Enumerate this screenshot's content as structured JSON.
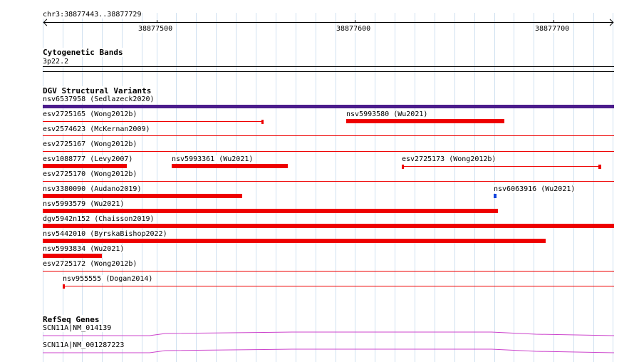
{
  "locus": "chr3:38877443..38877729",
  "ruler_ticks": [
    "38877500",
    "38877600",
    "38877700"
  ],
  "colors": {
    "grid": "#cfe0f0",
    "variant": "#ee0000",
    "variant_purple": "#4b1c8c",
    "variant_blue": "#1144dd",
    "gene": "#cc44cc"
  },
  "tracks": {
    "cytoband": {
      "title": "Cytogenetic Bands",
      "band": "3p22.2"
    },
    "dgv": {
      "title": "DGV Structural Variants",
      "variants": [
        {
          "label": "nsv6537958 (Sedlazeck2020)"
        },
        {
          "label": "esv2725165 (Wong2012b)"
        },
        {
          "label": "nsv5993580 (Wu2021)"
        },
        {
          "label": "esv2574623 (McKernan2009)"
        },
        {
          "label": "esv2725167 (Wong2012b)"
        },
        {
          "label": "esv1088777 (Levy2007)"
        },
        {
          "label": "nsv5993361 (Wu2021)"
        },
        {
          "label": "esv2725173 (Wong2012b)"
        },
        {
          "label": "esv2725170 (Wong2012b)"
        },
        {
          "label": "nsv3380090 (Audano2019)"
        },
        {
          "label": "nsv6063916 (Wu2021)"
        },
        {
          "label": "nsv5993579 (Wu2021)"
        },
        {
          "label": "dgv5942n152 (Chaisson2019)"
        },
        {
          "label": "nsv5442010 (ByrskaBishop2022)"
        },
        {
          "label": "nsv5993834 (Wu2021)"
        },
        {
          "label": "esv2725172 (Wong2012b)"
        },
        {
          "label": "nsv955555 (Dogan2014)"
        }
      ]
    },
    "refseq": {
      "title": "RefSeq Genes",
      "genes": [
        {
          "label": "SCN11A|NM_014139"
        },
        {
          "label": "SCN11A|NM_001287223"
        }
      ]
    }
  }
}
